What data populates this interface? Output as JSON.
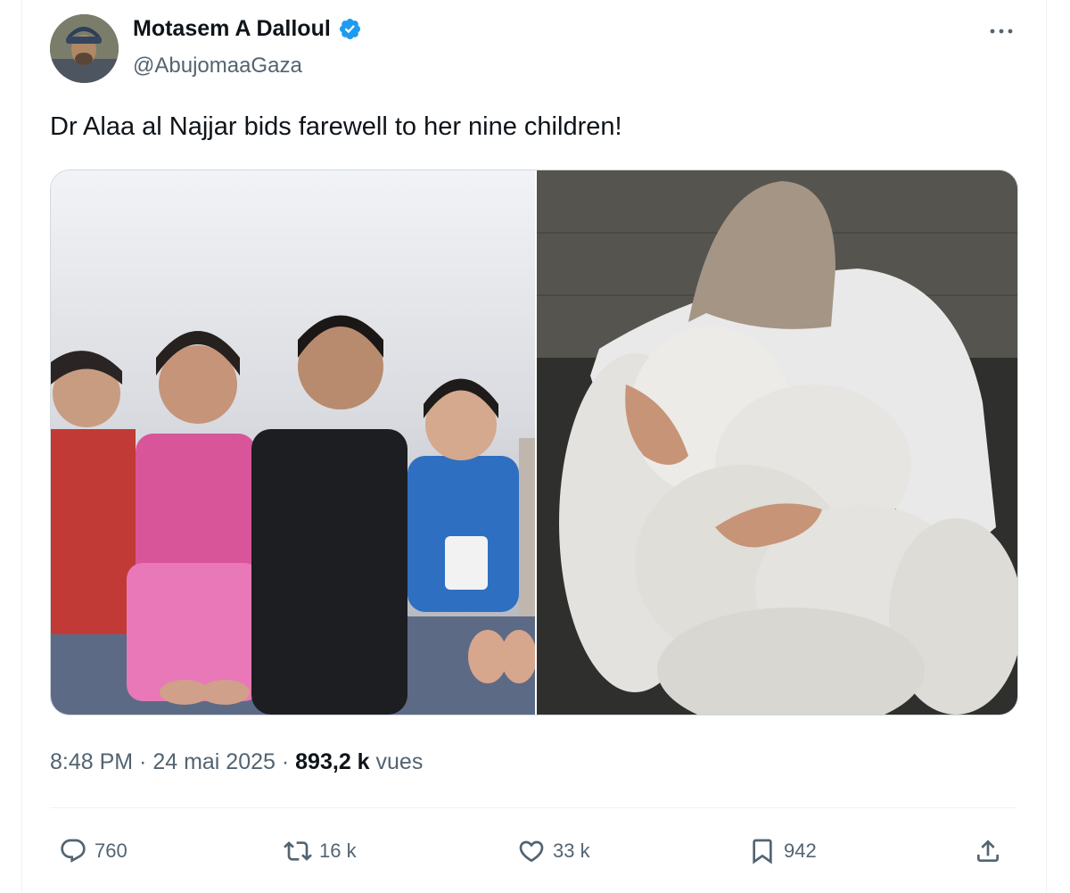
{
  "author": {
    "name": "Motasem A Dalloul",
    "handle": "@AbujomaaGaza",
    "verified": true,
    "avatar": "avatar"
  },
  "tweet": {
    "text": "Dr Alaa al Najjar bids farewell to her nine children!",
    "time": "8:48 PM",
    "separator": " · ",
    "date": "24 mai 2025",
    "views_count": "893,2 k",
    "views_label": " vues"
  },
  "media": [
    {
      "icon": "photo-children"
    },
    {
      "icon": "photo-mother-shrouds"
    }
  ],
  "actions": {
    "replies": "760",
    "reposts": "16 k",
    "likes": "33 k",
    "bookmarks": "942"
  },
  "colors": {
    "text": "#0f1419",
    "secondary": "#536471",
    "verified": "#1d9bf0",
    "border": "#cfd9de"
  }
}
